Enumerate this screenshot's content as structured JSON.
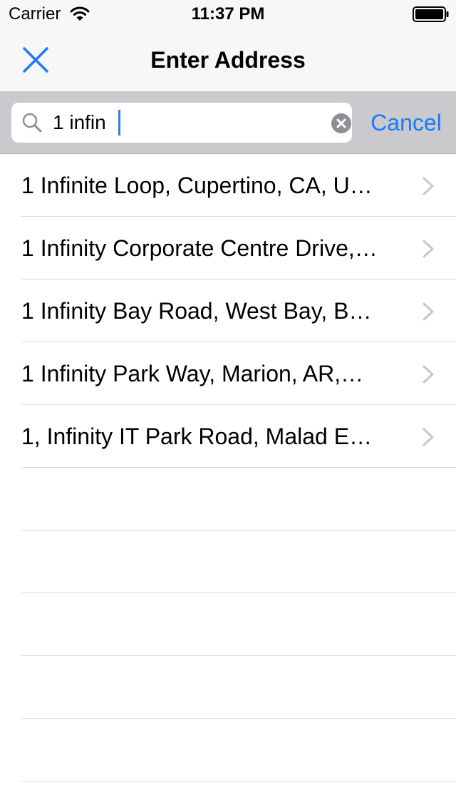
{
  "status_bar": {
    "carrier": "Carrier",
    "time": "11:37 PM",
    "wifi_icon": "wifi-icon",
    "battery_icon": "battery-icon"
  },
  "nav_bar": {
    "title": "Enter Address",
    "close_icon": "close-icon"
  },
  "search": {
    "value": "1 infin",
    "placeholder": "",
    "cancel_label": "Cancel",
    "search_icon": "search-icon",
    "clear_icon": "clear-icon"
  },
  "results": [
    {
      "label": "1 Infinite Loop, Cupertino, CA, U…"
    },
    {
      "label": "1 Infinity Corporate Centre Drive,…"
    },
    {
      "label": "1 Infinity Bay Road, West Bay, B…"
    },
    {
      "label": "1 Infinity Park Way, Marion, AR,…"
    },
    {
      "label": "1, Infinity IT Park Road, Malad E…"
    }
  ],
  "colors": {
    "accent": "#1a7cf5",
    "nav_background": "#f7f7f7",
    "search_bar_background": "#c9c9ce",
    "separator": "#d9d9dc",
    "chevron": "#c7c7cc"
  }
}
